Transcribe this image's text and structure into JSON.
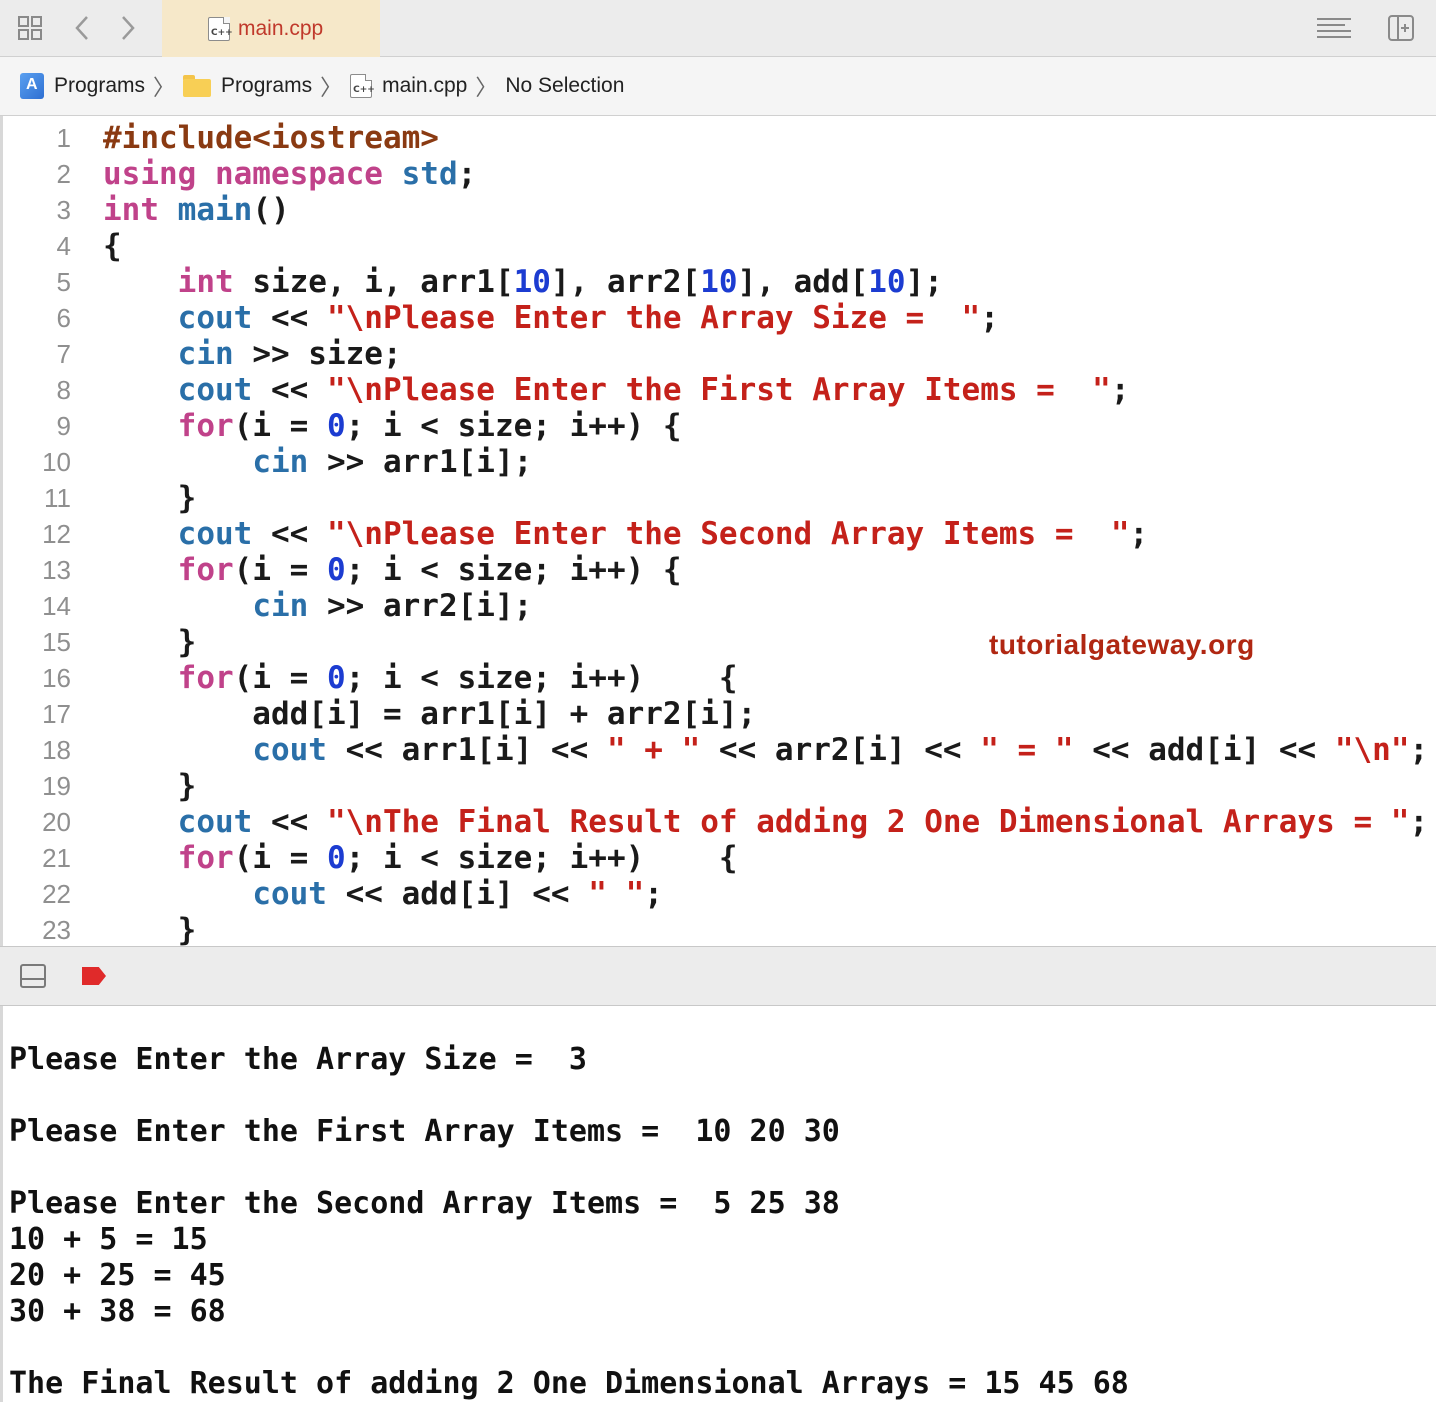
{
  "tabbar": {
    "active_tab": "main.cpp",
    "file_icon_text": "C++"
  },
  "jumpbar": {
    "project": "Programs",
    "folder": "Programs",
    "file": "main.cpp",
    "selection": "No Selection",
    "separator": "〉"
  },
  "editor": {
    "lines": [
      {
        "n": "1",
        "tokens": [
          {
            "t": "#include<iostream>",
            "c": "pp"
          }
        ]
      },
      {
        "n": "2",
        "tokens": [
          {
            "t": "using namespace",
            "c": "kw"
          },
          {
            "t": " ",
            "c": "plain"
          },
          {
            "t": "std",
            "c": "fn"
          },
          {
            "t": ";",
            "c": "plain"
          }
        ]
      },
      {
        "n": "3",
        "tokens": [
          {
            "t": "int",
            "c": "kw"
          },
          {
            "t": " ",
            "c": "plain"
          },
          {
            "t": "main",
            "c": "fn"
          },
          {
            "t": "()",
            "c": "plain"
          }
        ]
      },
      {
        "n": "4",
        "tokens": [
          {
            "t": "{",
            "c": "plain"
          }
        ]
      },
      {
        "n": "5",
        "tokens": [
          {
            "t": "    ",
            "c": "plain"
          },
          {
            "t": "int",
            "c": "kw"
          },
          {
            "t": " size, i, arr1[",
            "c": "plain"
          },
          {
            "t": "10",
            "c": "num"
          },
          {
            "t": "], arr2[",
            "c": "plain"
          },
          {
            "t": "10",
            "c": "num"
          },
          {
            "t": "], add[",
            "c": "plain"
          },
          {
            "t": "10",
            "c": "num"
          },
          {
            "t": "];",
            "c": "plain"
          }
        ]
      },
      {
        "n": "6",
        "tokens": [
          {
            "t": "    ",
            "c": "plain"
          },
          {
            "t": "cout",
            "c": "fn"
          },
          {
            "t": " << ",
            "c": "plain"
          },
          {
            "t": "\"\\nPlease Enter the Array Size =  \"",
            "c": "str"
          },
          {
            "t": ";",
            "c": "plain"
          }
        ]
      },
      {
        "n": "7",
        "tokens": [
          {
            "t": "    ",
            "c": "plain"
          },
          {
            "t": "cin",
            "c": "fn"
          },
          {
            "t": " >> size;",
            "c": "plain"
          }
        ]
      },
      {
        "n": "8",
        "tokens": [
          {
            "t": "    ",
            "c": "plain"
          },
          {
            "t": "cout",
            "c": "fn"
          },
          {
            "t": " << ",
            "c": "plain"
          },
          {
            "t": "\"\\nPlease Enter the First Array Items =  \"",
            "c": "str"
          },
          {
            "t": ";",
            "c": "plain"
          }
        ]
      },
      {
        "n": "9",
        "tokens": [
          {
            "t": "    ",
            "c": "plain"
          },
          {
            "t": "for",
            "c": "kw"
          },
          {
            "t": "(i = ",
            "c": "plain"
          },
          {
            "t": "0",
            "c": "num"
          },
          {
            "t": "; i < size; i++) {",
            "c": "plain"
          }
        ]
      },
      {
        "n": "10",
        "tokens": [
          {
            "t": "        ",
            "c": "plain"
          },
          {
            "t": "cin",
            "c": "fn"
          },
          {
            "t": " >> arr1[i];",
            "c": "plain"
          }
        ]
      },
      {
        "n": "11",
        "tokens": [
          {
            "t": "    }",
            "c": "plain"
          }
        ]
      },
      {
        "n": "12",
        "tokens": [
          {
            "t": "    ",
            "c": "plain"
          },
          {
            "t": "cout",
            "c": "fn"
          },
          {
            "t": " << ",
            "c": "plain"
          },
          {
            "t": "\"\\nPlease Enter the Second Array Items =  \"",
            "c": "str"
          },
          {
            "t": ";",
            "c": "plain"
          }
        ]
      },
      {
        "n": "13",
        "tokens": [
          {
            "t": "    ",
            "c": "plain"
          },
          {
            "t": "for",
            "c": "kw"
          },
          {
            "t": "(i = ",
            "c": "plain"
          },
          {
            "t": "0",
            "c": "num"
          },
          {
            "t": "; i < size; i++) {",
            "c": "plain"
          }
        ]
      },
      {
        "n": "14",
        "tokens": [
          {
            "t": "        ",
            "c": "plain"
          },
          {
            "t": "cin",
            "c": "fn"
          },
          {
            "t": " >> arr2[i];",
            "c": "plain"
          }
        ]
      },
      {
        "n": "15",
        "tokens": [
          {
            "t": "    }",
            "c": "plain"
          }
        ]
      },
      {
        "n": "16",
        "tokens": [
          {
            "t": "    ",
            "c": "plain"
          },
          {
            "t": "for",
            "c": "kw"
          },
          {
            "t": "(i = ",
            "c": "plain"
          },
          {
            "t": "0",
            "c": "num"
          },
          {
            "t": "; i < size; i++)    {",
            "c": "plain"
          }
        ]
      },
      {
        "n": "17",
        "tokens": [
          {
            "t": "        add[i] = arr1[i] + arr2[i];",
            "c": "plain"
          }
        ]
      },
      {
        "n": "18",
        "tokens": [
          {
            "t": "        ",
            "c": "plain"
          },
          {
            "t": "cout",
            "c": "fn"
          },
          {
            "t": " << arr1[i] << ",
            "c": "plain"
          },
          {
            "t": "\" + \"",
            "c": "str"
          },
          {
            "t": " << arr2[i] << ",
            "c": "plain"
          },
          {
            "t": "\" = \"",
            "c": "str"
          },
          {
            "t": " << add[i] << ",
            "c": "plain"
          },
          {
            "t": "\"\\n\"",
            "c": "str"
          },
          {
            "t": ";",
            "c": "plain"
          }
        ]
      },
      {
        "n": "19",
        "tokens": [
          {
            "t": "    }",
            "c": "plain"
          }
        ]
      },
      {
        "n": "20",
        "tokens": [
          {
            "t": "    ",
            "c": "plain"
          },
          {
            "t": "cout",
            "c": "fn"
          },
          {
            "t": " << ",
            "c": "plain"
          },
          {
            "t": "\"\\nThe Final Result of adding 2 One Dimensional Arrays = \"",
            "c": "str"
          },
          {
            "t": ";",
            "c": "plain"
          }
        ]
      },
      {
        "n": "21",
        "tokens": [
          {
            "t": "    ",
            "c": "plain"
          },
          {
            "t": "for",
            "c": "kw"
          },
          {
            "t": "(i = ",
            "c": "plain"
          },
          {
            "t": "0",
            "c": "num"
          },
          {
            "t": "; i < size; i++)    {",
            "c": "plain"
          }
        ]
      },
      {
        "n": "22",
        "tokens": [
          {
            "t": "        ",
            "c": "plain"
          },
          {
            "t": "cout",
            "c": "fn"
          },
          {
            "t": " << add[i] << ",
            "c": "plain"
          },
          {
            "t": "\" \"",
            "c": "str"
          },
          {
            "t": ";",
            "c": "plain"
          }
        ]
      },
      {
        "n": "23",
        "tokens": [
          {
            "t": "    }",
            "c": "plain"
          }
        ]
      }
    ],
    "watermark": "tutorialgateway.org"
  },
  "console": {
    "lines": [
      "",
      "Please Enter the Array Size =  3",
      "",
      "Please Enter the First Array Items =  10 20 30",
      "",
      "Please Enter the Second Array Items =  5 25 38",
      "10 + 5 = 15",
      "20 + 25 = 45",
      "30 + 38 = 68",
      "",
      "The Final Result of adding 2 One Dimensional Arrays = 15 45 68"
    ]
  },
  "colors": {
    "preprocessor": "#8a3a12",
    "keyword": "#c0428a",
    "function": "#2a6fa8",
    "number": "#1c3cd1",
    "string": "#c4211a",
    "tab_active_bg": "#f6e8c9",
    "breakpoint": "#e02a2a"
  }
}
